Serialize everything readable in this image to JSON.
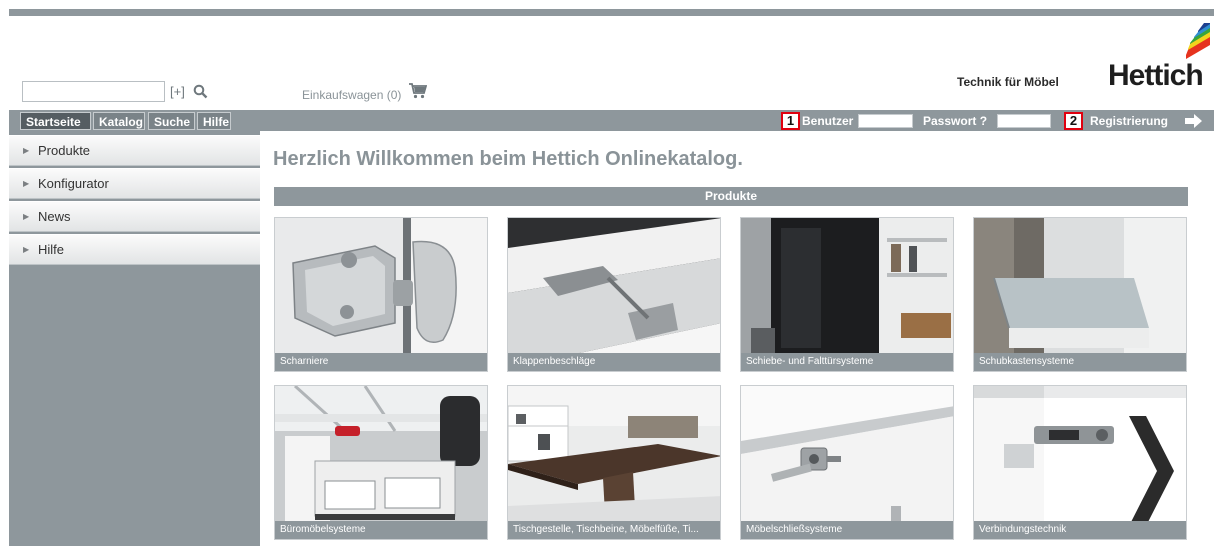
{
  "header": {
    "search": {
      "value": "",
      "placeholder": ""
    },
    "expand_link": "[+]",
    "search_icon": "search-icon",
    "cart": {
      "label": "Einkaufswagen (0)",
      "icon": "cart-icon"
    },
    "tagline": "Technik für Möbel",
    "logo_text": "Hettich"
  },
  "nav": {
    "tabs": [
      {
        "label": "Startseite",
        "active": true
      },
      {
        "label": "Katalog",
        "active": false
      },
      {
        "label": "Suche",
        "active": false
      },
      {
        "label": "Hilfe",
        "active": false
      }
    ],
    "badge1": "1",
    "benutzer_label": "Benutzer",
    "benutzer_value": "",
    "passwort_label": "Passwort ?",
    "passwort_value": "",
    "badge2": "2",
    "registrierung_label": "Registrierung",
    "registrierung_icon": "arrow-right-icon"
  },
  "sidebar": {
    "items": [
      {
        "label": "Produkte"
      },
      {
        "label": "Konfigurator"
      },
      {
        "label": "News"
      },
      {
        "label": "Hilfe"
      }
    ]
  },
  "main": {
    "welcome": "Herzlich Willkommen beim Hettich Onlinekatalog.",
    "section_title": "Produkte",
    "tiles": [
      {
        "caption": "Scharniere"
      },
      {
        "caption": "Klappenbeschläge"
      },
      {
        "caption": "Schiebe- und Falttürsysteme"
      },
      {
        "caption": "Schubkastensysteme"
      },
      {
        "caption": "Büromöbelsysteme"
      },
      {
        "caption": "Tischgestelle, Tischbeine, Möbelfüße, Ti..."
      },
      {
        "caption": "Möbelschließsysteme"
      },
      {
        "caption": "Verbindungstechnik"
      }
    ]
  },
  "colors": {
    "bar_grey": "#8e979c",
    "badge_red": "#e0000f",
    "logo_stripes": [
      "#1d3f8f",
      "#2f8fd1",
      "#3aa53a",
      "#f2d41c",
      "#e6331e"
    ]
  }
}
